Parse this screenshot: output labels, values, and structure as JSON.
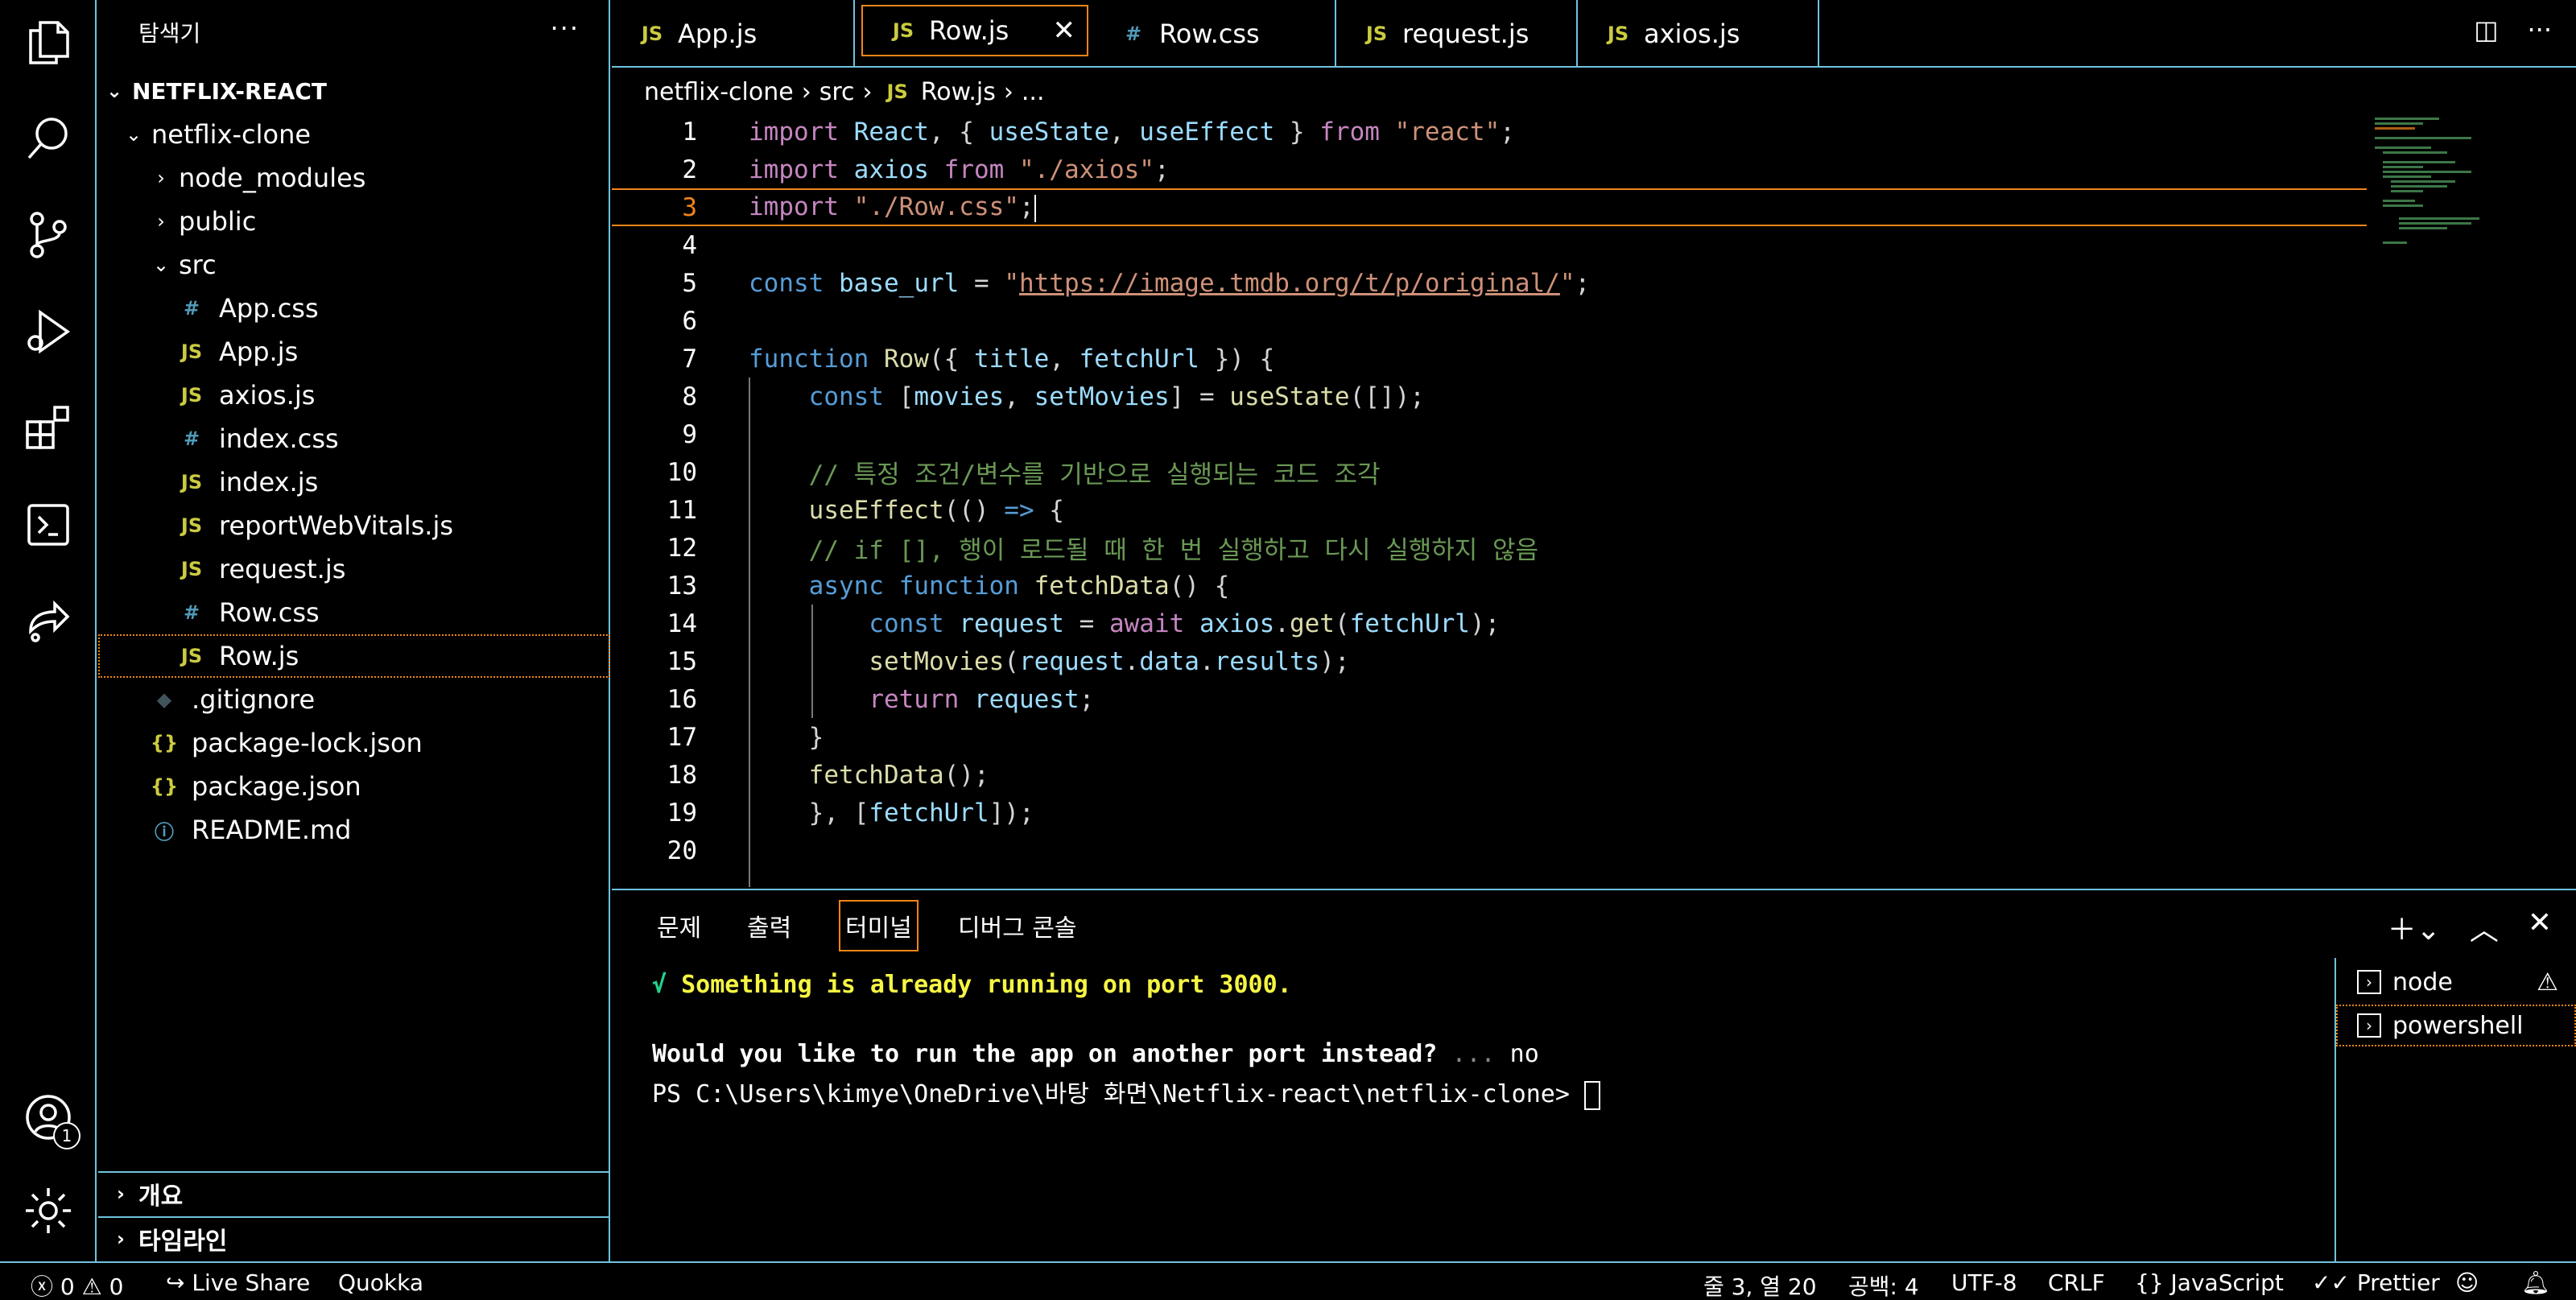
{
  "sidebar": {
    "title": "탐색기",
    "more": "···",
    "root": "NETFLIX-REACT",
    "tree": [
      {
        "label": "netflix-clone",
        "type": "folder-open"
      },
      {
        "label": "node_modules",
        "type": "folder"
      },
      {
        "label": "public",
        "type": "folder"
      },
      {
        "label": "src",
        "type": "folder-open"
      },
      {
        "label": "App.css",
        "type": "css"
      },
      {
        "label": "App.js",
        "type": "js"
      },
      {
        "label": "axios.js",
        "type": "js"
      },
      {
        "label": "index.css",
        "type": "css"
      },
      {
        "label": "index.js",
        "type": "js"
      },
      {
        "label": "reportWebVitals.js",
        "type": "js"
      },
      {
        "label": "request.js",
        "type": "js"
      },
      {
        "label": "Row.css",
        "type": "css"
      },
      {
        "label": "Row.js",
        "type": "js"
      },
      {
        "label": ".gitignore",
        "type": "git"
      },
      {
        "label": "package-lock.json",
        "type": "json"
      },
      {
        "label": "package.json",
        "type": "json"
      },
      {
        "label": "README.md",
        "type": "info"
      }
    ],
    "sections": [
      "개요",
      "타임라인"
    ]
  },
  "icons": {
    "js": "JS",
    "css": "#",
    "json": "{}",
    "info": "ⓘ",
    "git": "◆"
  },
  "tabs": [
    {
      "label": "App.js",
      "icon": "JS"
    },
    {
      "label": "Row.js",
      "icon": "JS"
    },
    {
      "label": "Row.css",
      "icon": "#"
    },
    {
      "label": "request.js",
      "icon": "JS"
    },
    {
      "label": "axios.js",
      "icon": "JS"
    }
  ],
  "breadcrumb": {
    "folder": "netflix-clone",
    "sub": "src",
    "file_icon": "JS",
    "file": "Row.js",
    "tail": "..."
  },
  "code": {
    "line_numbers": [
      "1",
      "2",
      "3",
      "4",
      "5",
      "6",
      "7",
      "8",
      "9",
      "10",
      "11",
      "12",
      "13",
      "14",
      "15",
      "16",
      "17",
      "18",
      "19",
      "20"
    ]
  },
  "panel": {
    "tabs": [
      "문제",
      "출력",
      "터미널",
      "디버그 콘솔"
    ],
    "terminal": {
      "check": "√",
      "running_msg": "Something is already running on port 3000.",
      "question": "Would you like to run the app on another port instead?",
      "dots": " ... ",
      "answer": "no",
      "prompt": "PS C:\\Users\\kimye\\OneDrive\\바탕 화면\\Netflix-react\\netflix-clone> "
    },
    "terminals": [
      "node",
      "powershell"
    ]
  },
  "status": {
    "errors": "0",
    "warnings": "0",
    "live_share": "Live Share",
    "quokka": "Quokka",
    "position": "줄 3, 열 20",
    "spaces": "공백: 4",
    "encoding": "UTF-8",
    "eol": "CRLF",
    "language": "JavaScript",
    "prettier": "Prettier",
    "badge": "1"
  }
}
